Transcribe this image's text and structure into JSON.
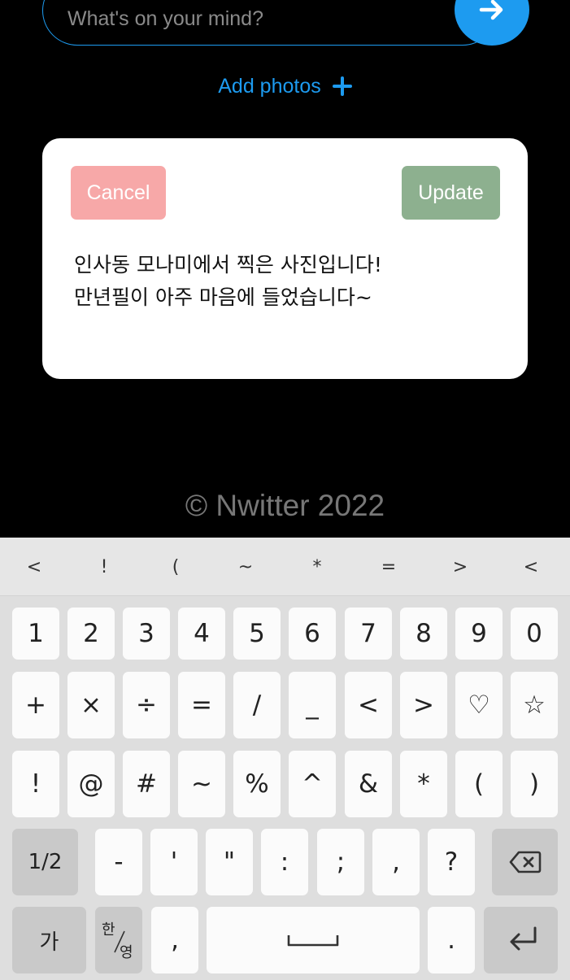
{
  "tweet_form": {
    "placeholder": "What's on your mind?",
    "submit_icon": "arrow-right-icon",
    "add_photos_label": "Add photos",
    "add_photos_icon": "plus-icon",
    "accent_color": "#1d9bf0"
  },
  "edit_card": {
    "cancel_label": "Cancel",
    "update_label": "Update",
    "cancel_color": "#f7a8a8",
    "update_color": "#8db08f",
    "text": "인사동 모나미에서 찍은 사진입니다!\n만년필이 아주 마음에 들었습니다~"
  },
  "footer": {
    "text": "© Nwitter 2022"
  },
  "keyboard": {
    "symbol_bar": [
      "<",
      "!",
      "(",
      "~",
      "*",
      "=",
      ">",
      "<"
    ],
    "row1": [
      "1",
      "2",
      "3",
      "4",
      "5",
      "6",
      "7",
      "8",
      "9",
      "0"
    ],
    "row2": [
      "+",
      "×",
      "÷",
      "=",
      "/",
      "_",
      "<",
      ">",
      "♡",
      "☆"
    ],
    "row3": [
      "!",
      "@",
      "#",
      "~",
      "%",
      "^",
      "&",
      "*",
      "(",
      ")"
    ],
    "row4": [
      "1/2",
      "-",
      "'",
      "\"",
      ":",
      ";",
      ",",
      "?",
      "⌫"
    ],
    "row5": {
      "lang": "가",
      "toggle_top": "한",
      "toggle_bottom": "영",
      "comma": ",",
      "space": "space",
      "period": ".",
      "enter": "enter"
    }
  }
}
